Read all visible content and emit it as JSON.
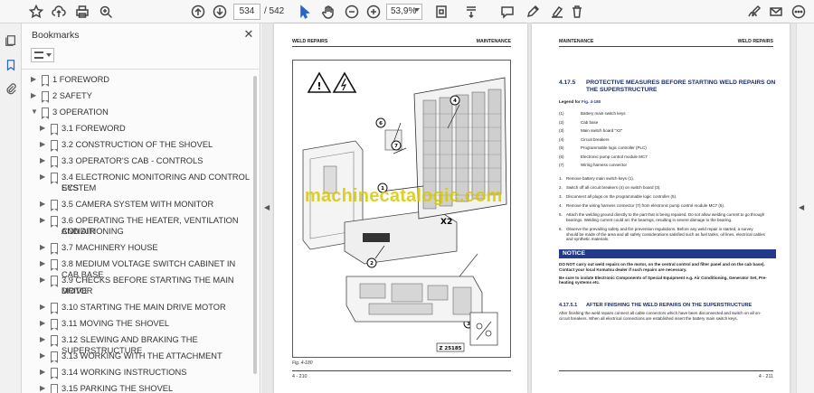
{
  "toolbar": {
    "page_current": "534",
    "page_total": "/ 542",
    "zoom": "53,9%",
    "icons": [
      "star-icon",
      "cloud-upload-icon",
      "print-icon",
      "zoom-search-icon",
      "page-up-icon",
      "page-down-icon",
      "select-cursor-icon",
      "hand-icon",
      "zoom-out-icon",
      "zoom-in-icon",
      "fit-page-icon",
      "scroll-mode-icon",
      "comment-icon",
      "pen-icon",
      "highlight-icon",
      "delete-icon",
      "sign-icon",
      "email-icon",
      "more-icon"
    ]
  },
  "rail": {
    "icons": [
      "pages-icon",
      "bookmark-icon",
      "attachment-icon"
    ]
  },
  "bookmarks": {
    "title": "Bookmarks",
    "close": "✕",
    "items": [
      {
        "label": "1 FOREWORD",
        "level": 0,
        "expanded": false
      },
      {
        "label": "2 SAFETY",
        "level": 0,
        "expanded": false
      },
      {
        "label": "3 OPERATION",
        "level": 0,
        "expanded": true
      },
      {
        "label": "3.1 FOREWORD",
        "level": 1,
        "expanded": false
      },
      {
        "label": "3.2 CONSTRUCTION OF THE SHOVEL",
        "level": 1,
        "expanded": false
      },
      {
        "label": "3.3 OPERATOR'S CAB - CONTROLS",
        "level": 1,
        "expanded": false
      },
      {
        "label": "3.4 ELECTRONIC MONITORING AND CONTROL SYSTEM",
        "label2": "ECS",
        "level": 1,
        "expanded": false
      },
      {
        "label": "3.5 CAMERA SYSTEM WITH MONITOR",
        "level": 1,
        "expanded": false
      },
      {
        "label": "3.6 OPERATING THE HEATER, VENTILATION AND AIR",
        "label2": "CONDITIONING",
        "level": 1,
        "expanded": false
      },
      {
        "label": "3.7 MACHINERY HOUSE",
        "level": 1,
        "expanded": false
      },
      {
        "label": "3.8 MEDIUM VOLTAGE SWITCH CABINET IN CAB BASE",
        "level": 1,
        "expanded": false
      },
      {
        "label": "3.9 CHECKS BEFORE STARTING THE MAIN DRIVE",
        "label2": "MOTOR",
        "level": 1,
        "expanded": false
      },
      {
        "label": "3.10 STARTING THE MAIN DRIVE MOTOR",
        "level": 1,
        "expanded": false
      },
      {
        "label": "3.11 MOVING THE SHOVEL",
        "level": 1,
        "expanded": false
      },
      {
        "label": "3.12 SLEWING AND BRAKING THE SUPERSTRUCTURE",
        "level": 1,
        "expanded": false
      },
      {
        "label": "3.13 WORKING WITH THE ATTACHMENT",
        "level": 1,
        "expanded": false
      },
      {
        "label": "3.14 WORKING INSTRUCTIONS",
        "level": 1,
        "expanded": false
      },
      {
        "label": "3.15 PARKING THE SHOVEL",
        "level": 1,
        "expanded": false
      }
    ]
  },
  "left_page": {
    "header_left": "WELD REPAIRS",
    "header_right": "MAINTENANCE",
    "figure_label": "Fig. 4-180",
    "figure_code": "Z 25185",
    "callouts": [
      "1",
      "2",
      "3",
      "4",
      "5",
      "6",
      "7",
      "X2"
    ],
    "footer": "4 - 210"
  },
  "right_page": {
    "header_left": "MAINTENANCE",
    "header_right": "WELD REPAIRS",
    "section_number": "4.17.5",
    "section_title": "PROTECTIVE MEASURES BEFORE STARTING WELD REPAIRS ON THE SUPERSTRUCTURE",
    "legend_prefix": "Legend for ",
    "legend_ref": "Fig. 4-180",
    "legend": [
      {
        "num": "(1)",
        "text": "Battery main switch keys"
      },
      {
        "num": "(2)",
        "text": "Cab base"
      },
      {
        "num": "(3)",
        "text": "Main switch board \"X2\""
      },
      {
        "num": "(4)",
        "text": "Circuit breakers"
      },
      {
        "num": "(5)",
        "text": "Programmable logic controller (PLC)"
      },
      {
        "num": "(6)",
        "text": "Electronic pump control module MC7"
      },
      {
        "num": "(7)",
        "text": "Wiring harness connector"
      }
    ],
    "steps": [
      {
        "num": "1.",
        "text": "Remove battery main switch keys (1)."
      },
      {
        "num": "2.",
        "text": "Switch off all circuit breakers (4) on switch board (3)."
      },
      {
        "num": "3.",
        "text": "Disconnect all plugs on the programmable logic controller (5)."
      },
      {
        "num": "4.",
        "text": "Remove the wiring harness connector (7) from electronic pump control module MC7 (6)."
      },
      {
        "num": "5.",
        "text": "Attach the welding ground directly to the part that is being repaired. Do not allow welding current to go through",
        "text2": "bearings. Welding current could arc the bearings, resulting in severe damage to the bearing."
      },
      {
        "num": "6.",
        "text": "Observe the prevailing safety and fire prevention regulations. Before any weld repair is started, a survey",
        "text2": "should be made of the area and all safety considerations satisfied such as fuel tanks, oil lines, electrical cables",
        "text3": "and synthetic materials."
      }
    ],
    "notice_label": "NOTICE",
    "notice_line1": "DO NOT carry out weld repairs on the motor, on the central control and filter panel and on the cab base).",
    "notice_line2": "Contact your local Komatsu dealer if such repairs are necessary.",
    "notice_line3": "Be sure to isolate Electronic Components of Special Equipment e.g. Air Conditioning, Generator Set, Pre-",
    "notice_line4": "heating systems etc.",
    "subsection_number": "4.17.5.1",
    "subsection_title": "AFTER FINISHING THE WELD REPAIRS ON THE SUPERSTRUCTURE",
    "subsection_line1": "After finishing the weld repairs connect all cable connectors which have been disconnected and switch on all on-",
    "subsection_line2": "circuit breakers. When all electrical connections are established insert the battery main switch keys.",
    "footer": "4 - 211"
  },
  "watermark": "machinecatalogic.com"
}
